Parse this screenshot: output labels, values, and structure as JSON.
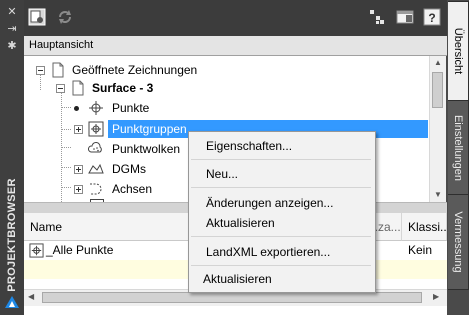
{
  "palette": {
    "tab_active": "#f0f0f0",
    "selection": "#3399ff",
    "dark_chrome": "#3c3c3c"
  },
  "panel": {
    "vertical_title": "PROJEKTBROWSER"
  },
  "tabs": [
    {
      "label": "Übersicht",
      "active": true
    },
    {
      "label": "Einstellungen",
      "active": false
    },
    {
      "label": "Vermessung",
      "active": false
    }
  ],
  "view": {
    "current": "Hauptansicht"
  },
  "tree": {
    "open_drawings": "Geöffnete Zeichnungen",
    "surface": "Surface - 3",
    "items": [
      "Punkte",
      "Punktgruppen",
      "Punktwolken",
      "DGMs",
      "Achsen"
    ]
  },
  "list": {
    "columns": [
      "Name",
      "...za...",
      "Klassi..."
    ],
    "rows": [
      {
        "name": "_Alle Punkte",
        "klass": "Kein"
      }
    ]
  },
  "context_menu": {
    "properties": "Eigenschaften...",
    "new": "Neu...",
    "show_changes": "Änderungen anzeigen...",
    "refresh": "Aktualisieren",
    "export_landxml": "LandXML exportieren...",
    "refresh_bottom": "Aktualisieren"
  }
}
